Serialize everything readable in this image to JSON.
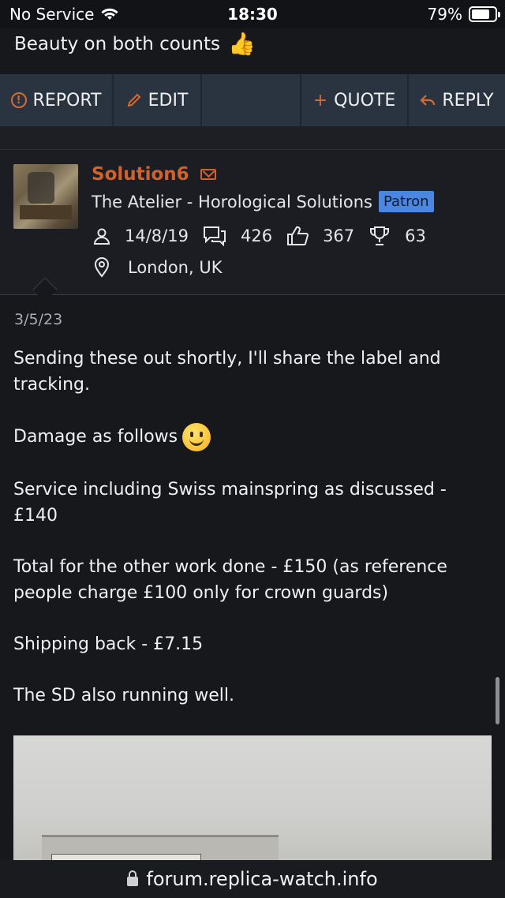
{
  "status_bar": {
    "carrier": "No Service",
    "time": "18:30",
    "battery": "79%",
    "battery_level": 0.79
  },
  "previous_post": {
    "text": "Beauty on both counts",
    "emoji": "👍"
  },
  "actions": {
    "report": "REPORT",
    "edit": "EDIT",
    "quote": "QUOTE",
    "reply": "REPLY"
  },
  "author": {
    "name": "Solution6",
    "title": "The Atelier - Horological Solutions",
    "badge": "Patron",
    "joined": "14/8/19",
    "messages": "426",
    "reactions": "367",
    "points": "63",
    "location": "London, UK"
  },
  "post": {
    "date": "3/5/23",
    "paragraphs": [
      "Sending these out shortly, I'll share the label and tracking.",
      "Damage as follows",
      "Service including Swiss mainspring as discussed - £140",
      "Total for the other work done - £150 (as reference people charge £100 only for crown guards)",
      "Shipping back - £7.15",
      "The SD also running well."
    ]
  },
  "url_bar": {
    "domain": "forum.replica-watch.info"
  },
  "colors": {
    "accent": "#d2622c",
    "action_bar": "#2a3340",
    "badge": "#4b86e0",
    "background": "#17181c"
  }
}
